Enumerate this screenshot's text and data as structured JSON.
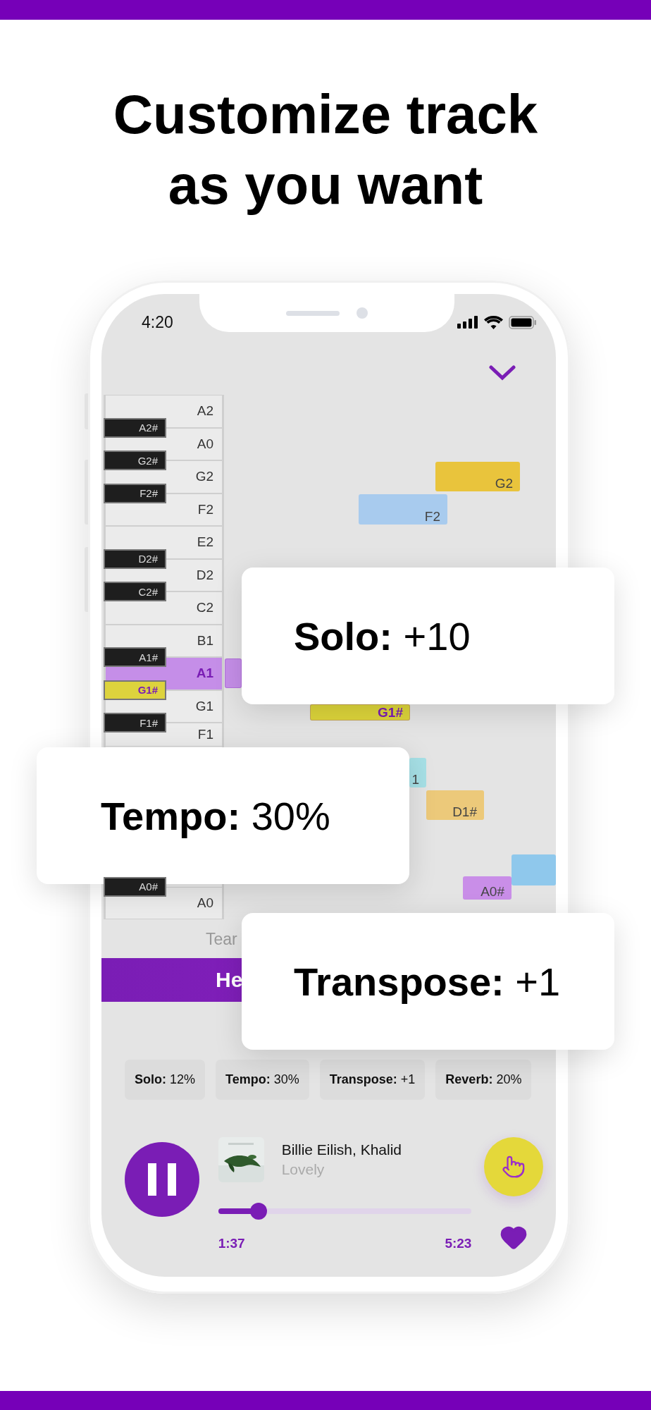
{
  "headline": [
    "Customize track",
    "as you want"
  ],
  "status_bar": {
    "time": "4:20"
  },
  "piano_keys": [
    {
      "label": "A2",
      "selected": false
    },
    {
      "label": "A0",
      "selected": false,
      "sharp": {
        "label": "A2#",
        "selected": false
      }
    },
    {
      "label": "G2",
      "selected": false,
      "sharp": {
        "label": "G2#",
        "selected": false
      }
    },
    {
      "label": "F2",
      "selected": false,
      "sharp": {
        "label": "F2#",
        "selected": false
      }
    },
    {
      "label": "E2",
      "selected": false
    },
    {
      "label": "D2",
      "selected": false,
      "sharp": {
        "label": "D2#",
        "selected": false
      }
    },
    {
      "label": "C2",
      "selected": false,
      "sharp": {
        "label": "C2#",
        "selected": false
      }
    },
    {
      "label": "B1",
      "selected": false
    },
    {
      "label": "A1",
      "selected": true,
      "sharp": {
        "label": "A1#",
        "selected": false
      }
    },
    {
      "label": "G1",
      "selected": false,
      "sharp": {
        "label": "G1#",
        "selected": true
      }
    },
    {
      "label": "F1",
      "selected": false,
      "sharp": {
        "label": "F1#",
        "selected": false
      }
    },
    {
      "label": "A0",
      "selected": false,
      "sharp": {
        "label": "A0#",
        "selected": false
      }
    }
  ],
  "notes": [
    {
      "label": "G2",
      "color": "#e9c43c",
      "selected": false
    },
    {
      "label": "F2",
      "color": "#a8cbee",
      "selected": false
    },
    {
      "color": "#c58ee8",
      "selected": true
    },
    {
      "label": "G1#",
      "color": "#dcd43a",
      "selected": true
    },
    {
      "label": "1",
      "color": "#a6e0e6",
      "selected": false
    },
    {
      "label": "D1#",
      "color": "#ecc97a",
      "selected": false
    },
    {
      "color": "#8fc8ec",
      "selected": false
    },
    {
      "label": "A0#",
      "color": "#c98ee8",
      "selected": false
    }
  ],
  "lyrics": {
    "previous": "Tear",
    "current": "He"
  },
  "settings": [
    {
      "label": "Solo:",
      "value": "12%"
    },
    {
      "label": "Tempo:",
      "value": "30%"
    },
    {
      "label": "Transpose:",
      "value": "+1"
    },
    {
      "label": "Reverb:",
      "value": "20%"
    }
  ],
  "player": {
    "artist": "Billie Eilish, Khalid",
    "title": "Lovely",
    "level": 0.16,
    "elapsed": "1:37",
    "duration": "5:23",
    "playing": true,
    "liked": true
  },
  "callouts": [
    {
      "label": "Solo:",
      "value": "+10"
    },
    {
      "label": "Tempo:",
      "value": "30%"
    },
    {
      "label": "Transpose:",
      "value": "+1"
    }
  ]
}
